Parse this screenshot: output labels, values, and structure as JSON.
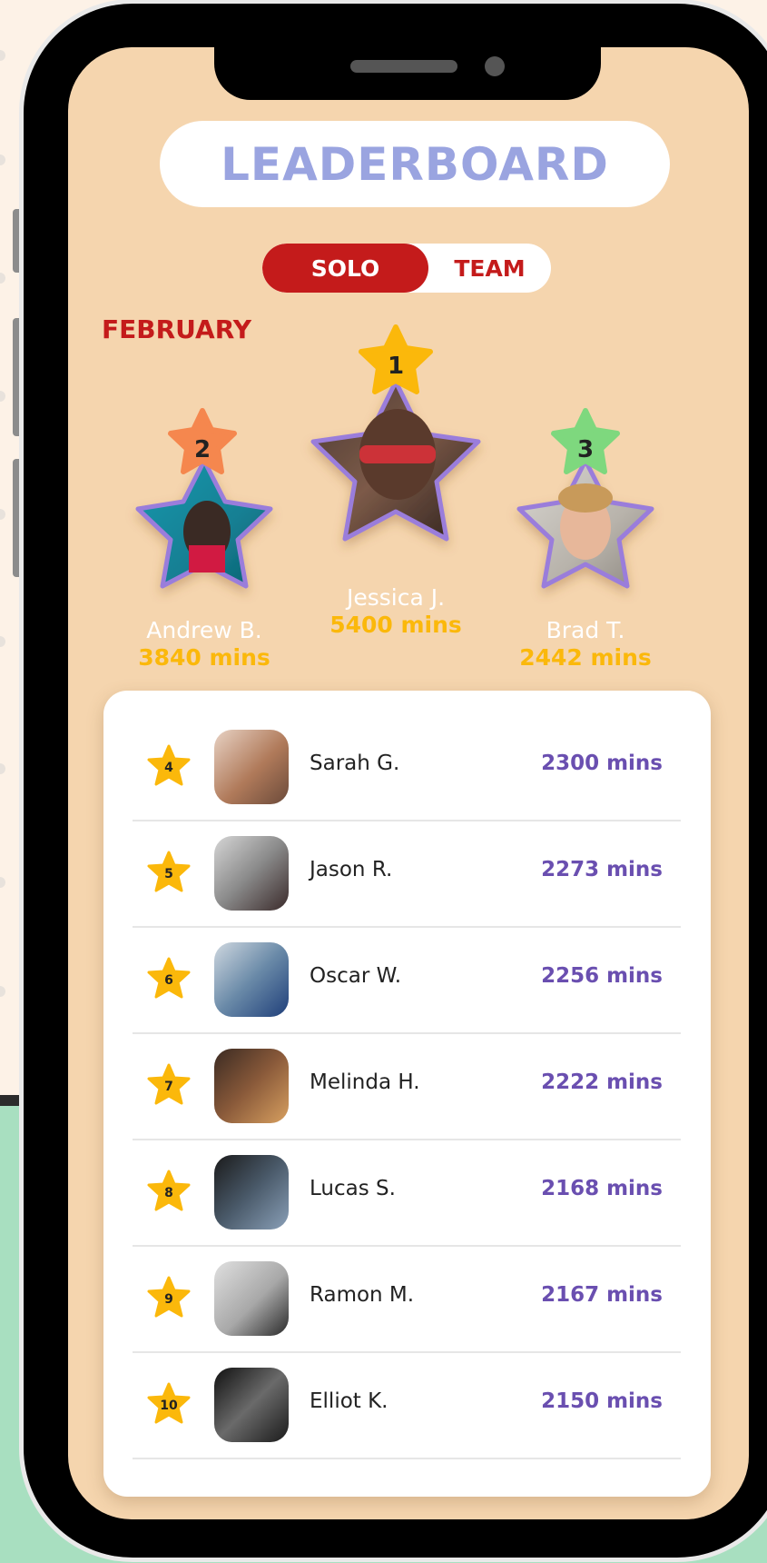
{
  "header": {
    "title": "LEADERBOARD"
  },
  "toggle": {
    "solo_label": "SOLO",
    "team_label": "TEAM",
    "selected": "SOLO"
  },
  "period": {
    "month": "FEBRUARY"
  },
  "podium": [
    {
      "rank": "1",
      "name": "Jessica J.",
      "score": "5400 mins",
      "star_color": "#fbb80b"
    },
    {
      "rank": "2",
      "name": "Andrew B.",
      "score": "3840 mins",
      "star_color": "#f5874e"
    },
    {
      "rank": "3",
      "name": "Brad T.",
      "score": "2442 mins",
      "star_color": "#7ed87e"
    }
  ],
  "list": [
    {
      "rank": "4",
      "name": "Sarah G.",
      "score": "2300 mins"
    },
    {
      "rank": "5",
      "name": "Jason R.",
      "score": "2273 mins"
    },
    {
      "rank": "6",
      "name": "Oscar W.",
      "score": "2256 mins"
    },
    {
      "rank": "7",
      "name": "Melinda H.",
      "score": "2222 mins"
    },
    {
      "rank": "8",
      "name": "Lucas S.",
      "score": "2168 mins"
    },
    {
      "rank": "9",
      "name": "Ramon M.",
      "score": "2167 mins"
    },
    {
      "rank": "10",
      "name": "Elliot K.",
      "score": "2150 mins"
    }
  ],
  "colors": {
    "accent_red": "#c41b1b",
    "title_blue": "#9aa4e0",
    "score_purple": "#6a4fb0",
    "gold": "#fbb80b",
    "screen_bg": "#f5d5ae",
    "frame_purple": "#9a7ddb"
  }
}
